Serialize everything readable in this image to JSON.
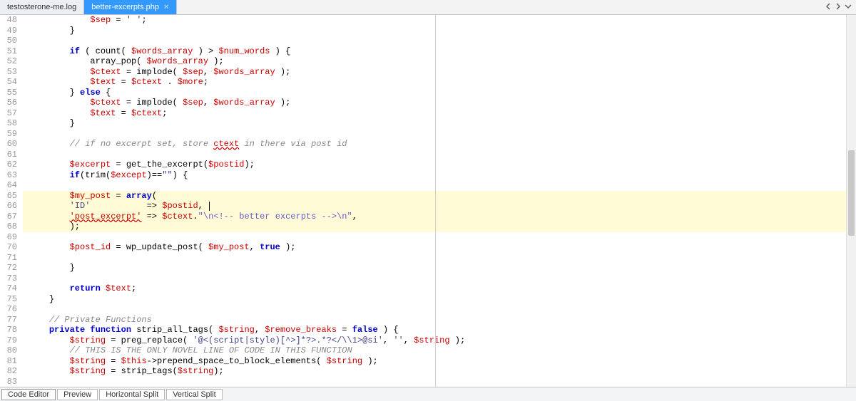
{
  "tabs": {
    "inactive": "testosterone-me.log",
    "active": "better-excerpts.php"
  },
  "bottom_tabs": {
    "t0": "Code Editor",
    "t1": "Preview",
    "t2": "Horizontal Split",
    "t3": "Vertical Split"
  },
  "gutter_start": 48,
  "gutter_end": 83,
  "code": {
    "l48": {
      "i": "            ",
      "a": "$sep",
      "b": " = ",
      "c": "' '",
      "d": ";"
    },
    "l49": {
      "i": "        ",
      "a": "}"
    },
    "l50": {
      "a": ""
    },
    "l51": {
      "i": "        ",
      "k": "if",
      "a": " ( count( ",
      "v1": "$words_array",
      "b": " ) > ",
      "v2": "$num_words",
      "c": " ) {"
    },
    "l52": {
      "i": "            ",
      "a": "array_pop( ",
      "v1": "$words_array",
      "b": " );"
    },
    "l53": {
      "i": "            ",
      "v1": "$ctext",
      "a": " = implode( ",
      "v2": "$sep",
      "b": ", ",
      "v3": "$words_array",
      "c": " );"
    },
    "l54": {
      "i": "            ",
      "v1": "$text",
      "a": " = ",
      "v2": "$ctext",
      "b": " . ",
      "v3": "$more",
      "c": ";"
    },
    "l55": {
      "i": "        ",
      "a": "} ",
      "k": "else",
      "b": " {"
    },
    "l56": {
      "i": "            ",
      "v1": "$ctext",
      "a": " = implode( ",
      "v2": "$sep",
      "b": ", ",
      "v3": "$words_array",
      "c": " );"
    },
    "l57": {
      "i": "            ",
      "v1": "$text",
      "a": " = ",
      "v2": "$ctext",
      "b": ";"
    },
    "l58": {
      "i": "        ",
      "a": "}"
    },
    "l59": {
      "a": ""
    },
    "l60": {
      "i": "        ",
      "c": "// if no excerpt set, store ",
      "u": "ctext",
      "c2": " in there via post id"
    },
    "l61": {
      "a": ""
    },
    "l62": {
      "i": "        ",
      "v1": "$excerpt",
      "a": " = get_the_excerpt(",
      "v2": "$postid",
      "b": ");"
    },
    "l63": {
      "i": "        ",
      "k": "if",
      "a": "(trim(",
      "v1": "$except",
      "b": ")==",
      "s": "\"\"",
      "c": ") {"
    },
    "l64": {
      "a": ""
    },
    "l65": {
      "i": "        ",
      "v1": "$my_post",
      "a": " = ",
      "k": "array",
      "b": "("
    },
    "l66": {
      "i": "        ",
      "s": "'ID'",
      "a": "           => ",
      "v1": "$postid",
      "b": ", "
    },
    "l67": {
      "i": "        ",
      "u": "'post_excerpt'",
      "a": " => ",
      "v1": "$ctext",
      "b": ".",
      "s": "\"\\n<!-- better excerpts -->\\n\"",
      "c": ","
    },
    "l68": {
      "i": "        ",
      "a": ");"
    },
    "l69": {
      "a": ""
    },
    "l70": {
      "i": "        ",
      "v1": "$post_id",
      "a": " = wp_update_post( ",
      "v2": "$my_post",
      "b": ", ",
      "k": "true",
      "c": " );"
    },
    "l71": {
      "a": ""
    },
    "l72": {
      "i": "        ",
      "a": "}"
    },
    "l73": {
      "a": ""
    },
    "l74": {
      "i": "        ",
      "k": "return",
      "a": " ",
      "v1": "$text",
      "b": ";"
    },
    "l75": {
      "i": "    ",
      "a": "}"
    },
    "l76": {
      "a": ""
    },
    "l77": {
      "i": "    ",
      "c": "// Private Functions"
    },
    "l78": {
      "i": "    ",
      "k": "private function",
      "a": " strip_all_tags( ",
      "v1": "$string",
      "b": ", ",
      "v2": "$remove_breaks",
      "c": " = ",
      "k2": "false",
      "d": " ) {"
    },
    "l79": {
      "i": "        ",
      "v1": "$string",
      "a": " = preg_replace( ",
      "s": "'@<(script|style)[^>]*?>.*?</\\\\1>@si'",
      "b": ", ",
      "s2": "''",
      "c": ", ",
      "v2": "$string",
      "d": " );"
    },
    "l80": {
      "i": "        ",
      "c": "// THIS IS THE ONLY NOVEL LINE OF CODE IN THIS FUNCTION"
    },
    "l81": {
      "i": "        ",
      "v1": "$string",
      "a": " = ",
      "v2": "$this",
      "b": "->prepend_space_to_block_elements( ",
      "v3": "$string",
      "c": " );"
    },
    "l82": {
      "i": "        ",
      "v1": "$string",
      "a": " = strip_tags(",
      "v2": "$string",
      "b": ");"
    },
    "l83": {
      "a": ""
    }
  }
}
